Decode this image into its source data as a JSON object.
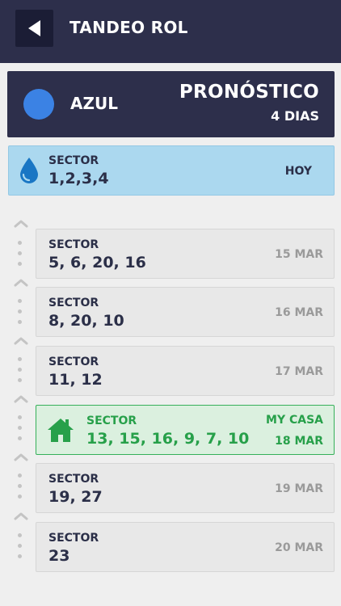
{
  "header": {
    "title": "TANDEO ROL",
    "back_icon": "back-arrow-icon"
  },
  "forecast": {
    "color_name": "AZUL",
    "color_hex": "#3b82e4",
    "title": "PRONÓSTICO",
    "days": "4 DIAS"
  },
  "today": {
    "sector_label": "SECTOR",
    "sectors": "1,2,3,4",
    "day_label": "HOY",
    "icon": "water-drop-icon"
  },
  "schedule": [
    {
      "sector_label": "SECTOR",
      "sectors": "5, 6, 20, 16",
      "date": "15 MAR"
    },
    {
      "sector_label": "SECTOR",
      "sectors": "8, 20, 10",
      "date": "16 MAR"
    },
    {
      "sector_label": "SECTOR",
      "sectors": "11, 12",
      "date": "17 MAR"
    },
    {
      "sector_label": "SECTOR",
      "sectors": "13, 15, 16, 9, 7, 10",
      "date": "18 MAR",
      "home_label": "MY CASA",
      "icon": "home-icon"
    },
    {
      "sector_label": "SECTOR",
      "sectors": "19, 27",
      "date": "19 MAR"
    },
    {
      "sector_label": "SECTOR",
      "sectors": "23",
      "date": "20 MAR"
    }
  ]
}
